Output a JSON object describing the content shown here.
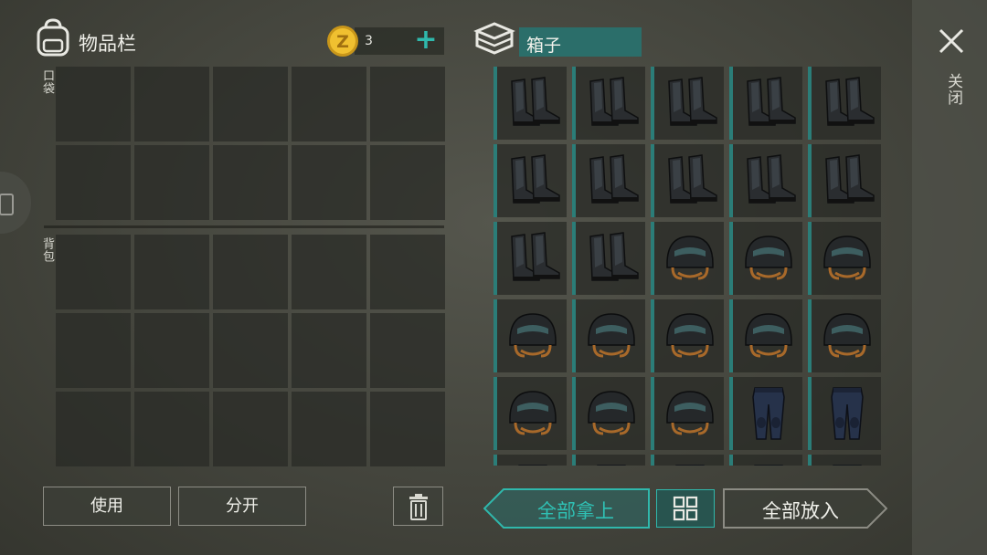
{
  "inventory": {
    "title": "物品栏",
    "coins": "3",
    "add_coin_label": "+",
    "pocket_label": "口袋",
    "backpack_label": "背包",
    "pocket_slots": 10,
    "backpack_slots": 15
  },
  "actions": {
    "use_label": "使用",
    "split_label": "分开",
    "trash_icon": "trash-icon"
  },
  "container": {
    "title": "箱子",
    "close_label": "关闭",
    "items": [
      "boots",
      "boots",
      "boots",
      "boots",
      "boots",
      "boots",
      "boots",
      "boots",
      "boots",
      "boots",
      "boots",
      "boots",
      "helmet",
      "helmet",
      "helmet",
      "helmet",
      "helmet",
      "helmet",
      "helmet",
      "helmet",
      "helmet",
      "helmet",
      "helmet",
      "pants",
      "pants",
      "pants",
      "pants",
      "pants",
      "pants",
      "pants"
    ]
  },
  "transfer": {
    "take_all_label": "全部拿上",
    "put_all_label": "全部放入",
    "sort_icon": "grid-sort-icon"
  },
  "colors": {
    "accent": "#2fb8ac",
    "title_bar": "#2b6e6a",
    "coin": "#e0b020"
  }
}
